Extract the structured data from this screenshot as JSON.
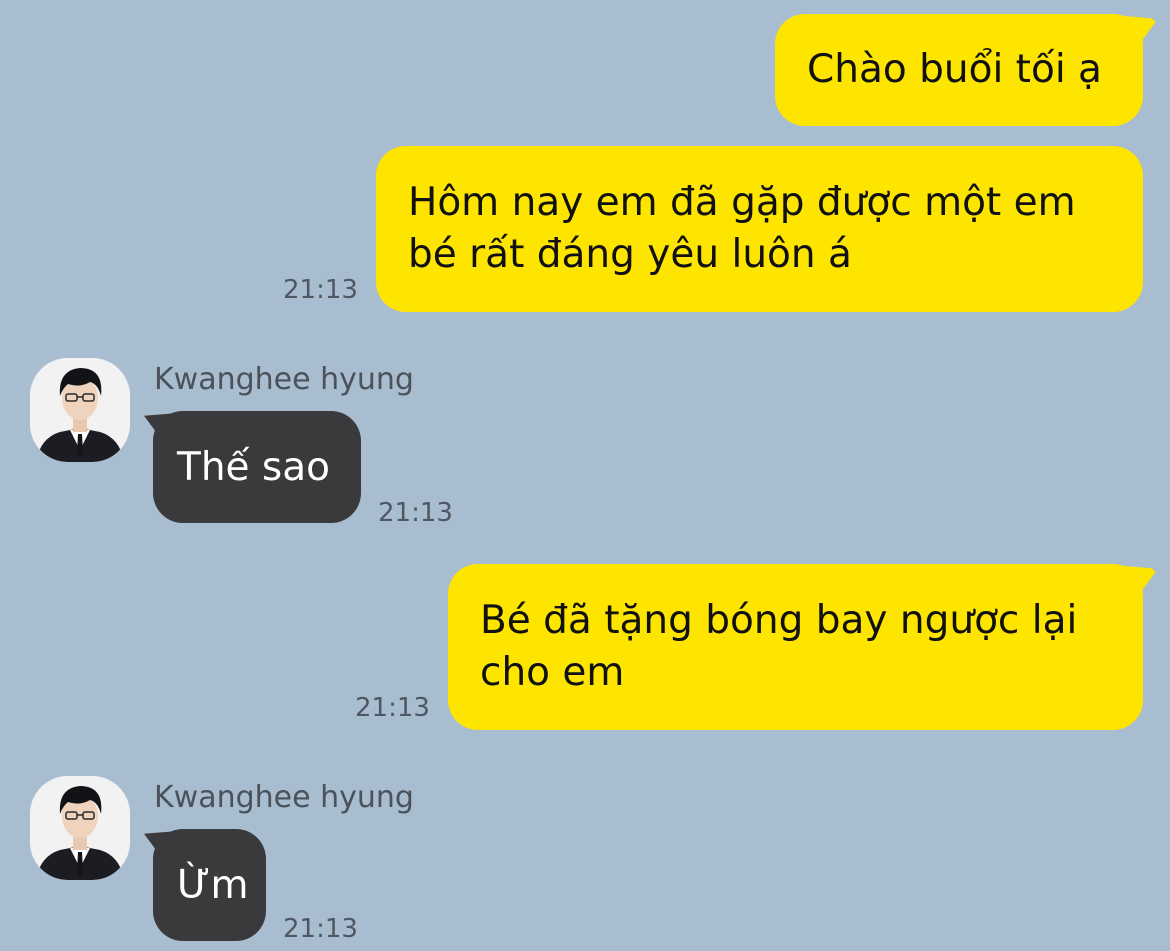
{
  "colors": {
    "background": "#a9bdd0",
    "outgoing_bubble": "#fee500",
    "incoming_bubble": "#3a3a3c",
    "timestamp": "#4f5862"
  },
  "messages": [
    {
      "direction": "outgoing",
      "text": "Chào buổi tối ạ"
    },
    {
      "direction": "outgoing",
      "lines": [
        "Hôm nay em đã gặp được một em",
        "bé rất đáng yêu luôn á"
      ],
      "time": "21:13"
    },
    {
      "direction": "incoming",
      "sender": "Kwanghee hyung",
      "avatar_icon": "profile-photo-avatar",
      "text": "Thế sao",
      "time": "21:13"
    },
    {
      "direction": "outgoing",
      "lines": [
        "Bé đã tặng bóng bay ngược lại",
        "cho em"
      ],
      "time": "21:13"
    },
    {
      "direction": "incoming",
      "sender": "Kwanghee hyung",
      "avatar_icon": "profile-photo-avatar",
      "text": "Ừm",
      "time": "21:13"
    }
  ]
}
